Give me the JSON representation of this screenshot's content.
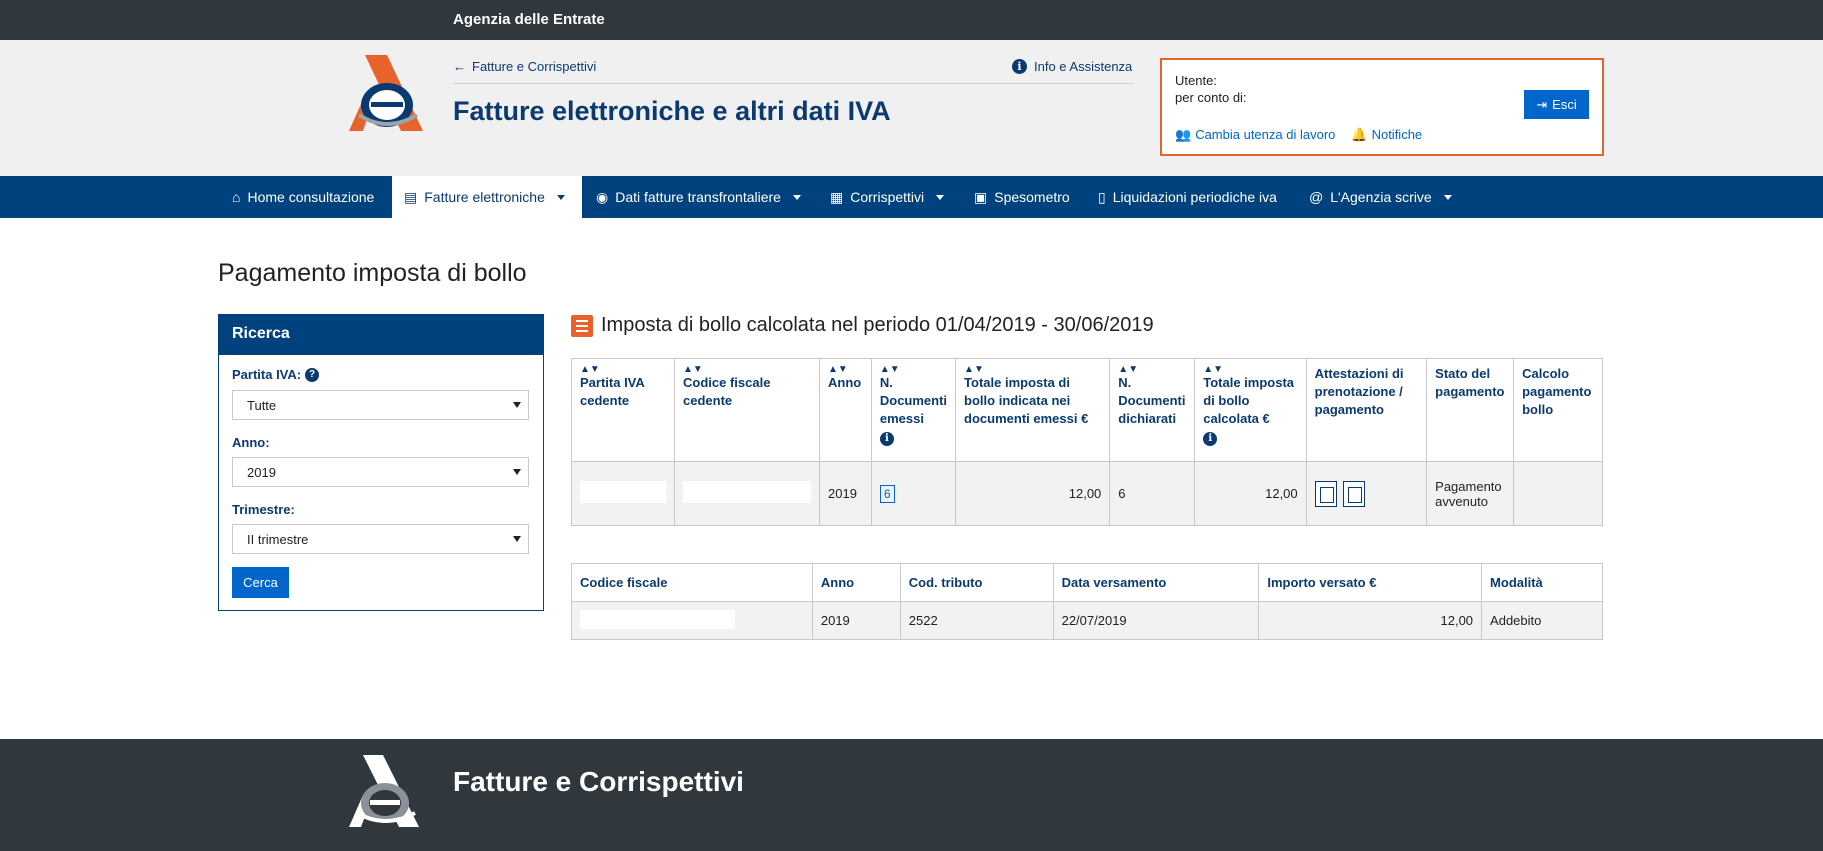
{
  "topbar": {
    "brand": "Agenzia delle Entrate"
  },
  "header": {
    "back_link": "Fatture e Corrispettivi",
    "info_link": "Info e Assistenza",
    "app_title": "Fatture elettroniche e altri dati IVA",
    "user": {
      "utente_label": "Utente:",
      "per_conto_label": "per conto di:",
      "logout_label": "Esci",
      "change_user_label": "Cambia utenza di lavoro",
      "notifications_label": "Notifiche"
    }
  },
  "nav": {
    "items": [
      {
        "label": "Home consultazione",
        "icon": "home-icon"
      },
      {
        "label": "Fatture elettroniche",
        "icon": "document-icon",
        "active": true
      },
      {
        "label": "Dati fatture transfrontaliere",
        "icon": "globe-icon"
      },
      {
        "label": "Corrispettivi",
        "icon": "calculator-icon"
      },
      {
        "label": "Spesometro",
        "icon": "bag-icon"
      },
      {
        "label": "Liquidazioni periodiche iva",
        "icon": "file-icon"
      },
      {
        "label": "L'Agenzia scrive",
        "icon": "at-icon"
      }
    ]
  },
  "page": {
    "title": "Pagamento imposta di bollo"
  },
  "search": {
    "title": "Ricerca",
    "partita_iva_label": "Partita IVA:",
    "partita_iva_value": "Tutte",
    "anno_label": "Anno:",
    "anno_value": "2019",
    "trimestre_label": "Trimestre:",
    "trimestre_value": "II trimestre",
    "button": "Cerca"
  },
  "section": {
    "title": "Imposta di bollo calcolata nel periodo 01/04/2019 - 30/06/2019"
  },
  "table1": {
    "headers": [
      "Partita IVA cedente",
      "Codice fiscale cedente",
      "Anno",
      "N. Documenti emessi",
      "Totale imposta di bollo indicata nei documenti emessi €",
      "N. Documenti dichiarati",
      "Totale imposta di bollo calcolata €",
      "Attestazioni di prenotazione / pagamento",
      "Stato del pagamento",
      "Calcolo pagamento bollo"
    ],
    "row": {
      "anno": "2019",
      "n_documenti": "6",
      "totale_indicata": "12,00",
      "n_dichiarati": "6",
      "totale_calcolata": "12,00",
      "stato": "Pagamento avvenuto"
    }
  },
  "table2": {
    "headers": [
      "Codice fiscale",
      "Anno",
      "Cod. tributo",
      "Data versamento",
      "Importo versato €",
      "Modalità"
    ],
    "row": {
      "anno": "2019",
      "cod_tributo": "2522",
      "data": "22/07/2019",
      "importo": "12,00",
      "modalita": "Addebito"
    }
  },
  "footer": {
    "title": "Fatture e Corrispettivi"
  },
  "colors": {
    "brand_blue": "#00427d",
    "accent_orange": "#e8632b",
    "button_blue": "#0066cc"
  }
}
